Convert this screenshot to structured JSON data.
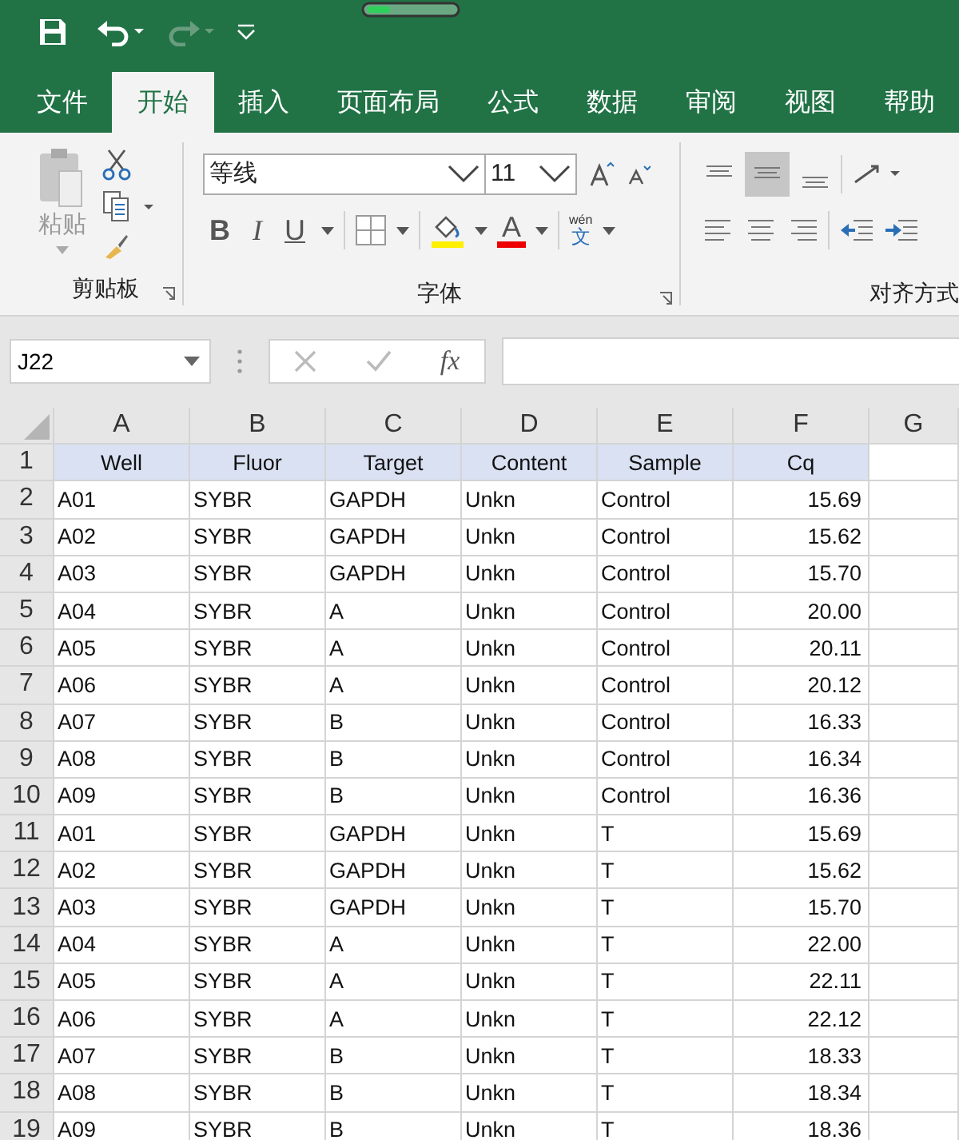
{
  "ribbon_tabs": [
    {
      "label": "文件",
      "selected": false
    },
    {
      "label": "开始",
      "selected": true
    },
    {
      "label": "插入",
      "selected": false
    },
    {
      "label": "页面布局",
      "selected": false
    },
    {
      "label": "公式",
      "selected": false
    },
    {
      "label": "数据",
      "selected": false
    },
    {
      "label": "审阅",
      "selected": false
    },
    {
      "label": "视图",
      "selected": false
    },
    {
      "label": "帮助",
      "selected": false
    }
  ],
  "clipboard": {
    "paste_label": "粘贴",
    "group_label": "剪贴板"
  },
  "font": {
    "name": "等线",
    "size": "11",
    "bold": "B",
    "italic": "I",
    "underline": "U",
    "font_color": "A",
    "phonetic_top": "wén",
    "phonetic_bottom": "文",
    "group_label": "字体"
  },
  "alignment": {
    "group_label": "对齐方式"
  },
  "formula_bar": {
    "name_box": "J22",
    "fx": "fx"
  },
  "sheet": {
    "columns": [
      "A",
      "B",
      "C",
      "D",
      "E",
      "F",
      "G"
    ],
    "header_row": {
      "number": "1",
      "cells": [
        "Well",
        "Fluor",
        "Target",
        "Content",
        "Sample",
        "Cq"
      ]
    },
    "rows": [
      {
        "number": "2",
        "cells": [
          "A01",
          "SYBR",
          "GAPDH",
          "Unkn",
          "Control",
          "15.69"
        ]
      },
      {
        "number": "3",
        "cells": [
          "A02",
          "SYBR",
          "GAPDH",
          "Unkn",
          "Control",
          "15.62"
        ]
      },
      {
        "number": "4",
        "cells": [
          "A03",
          "SYBR",
          "GAPDH",
          "Unkn",
          "Control",
          "15.70"
        ]
      },
      {
        "number": "5",
        "cells": [
          "A04",
          "SYBR",
          "A",
          "Unkn",
          "Control",
          "20.00"
        ]
      },
      {
        "number": "6",
        "cells": [
          "A05",
          "SYBR",
          "A",
          "Unkn",
          "Control",
          "20.11"
        ]
      },
      {
        "number": "7",
        "cells": [
          "A06",
          "SYBR",
          "A",
          "Unkn",
          "Control",
          "20.12"
        ]
      },
      {
        "number": "8",
        "cells": [
          "A07",
          "SYBR",
          "B",
          "Unkn",
          "Control",
          "16.33"
        ]
      },
      {
        "number": "9",
        "cells": [
          "A08",
          "SYBR",
          "B",
          "Unkn",
          "Control",
          "16.34"
        ]
      },
      {
        "number": "10",
        "cells": [
          "A09",
          "SYBR",
          "B",
          "Unkn",
          "Control",
          "16.36"
        ]
      },
      {
        "number": "11",
        "cells": [
          "A01",
          "SYBR",
          "GAPDH",
          "Unkn",
          "T",
          "15.69"
        ]
      },
      {
        "number": "12",
        "cells": [
          "A02",
          "SYBR",
          "GAPDH",
          "Unkn",
          "T",
          "15.62"
        ]
      },
      {
        "number": "13",
        "cells": [
          "A03",
          "SYBR",
          "GAPDH",
          "Unkn",
          "T",
          "15.70"
        ]
      },
      {
        "number": "14",
        "cells": [
          "A04",
          "SYBR",
          "A",
          "Unkn",
          "T",
          "22.00"
        ]
      },
      {
        "number": "15",
        "cells": [
          "A05",
          "SYBR",
          "A",
          "Unkn",
          "T",
          "22.11"
        ]
      },
      {
        "number": "16",
        "cells": [
          "A06",
          "SYBR",
          "A",
          "Unkn",
          "T",
          "22.12"
        ]
      },
      {
        "number": "17",
        "cells": [
          "A07",
          "SYBR",
          "B",
          "Unkn",
          "T",
          "18.33"
        ]
      },
      {
        "number": "18",
        "cells": [
          "A08",
          "SYBR",
          "B",
          "Unkn",
          "T",
          "18.34"
        ]
      },
      {
        "number": "19",
        "cells": [
          "A09",
          "SYBR",
          "B",
          "Unkn",
          "T",
          "18.36"
        ]
      }
    ]
  }
}
